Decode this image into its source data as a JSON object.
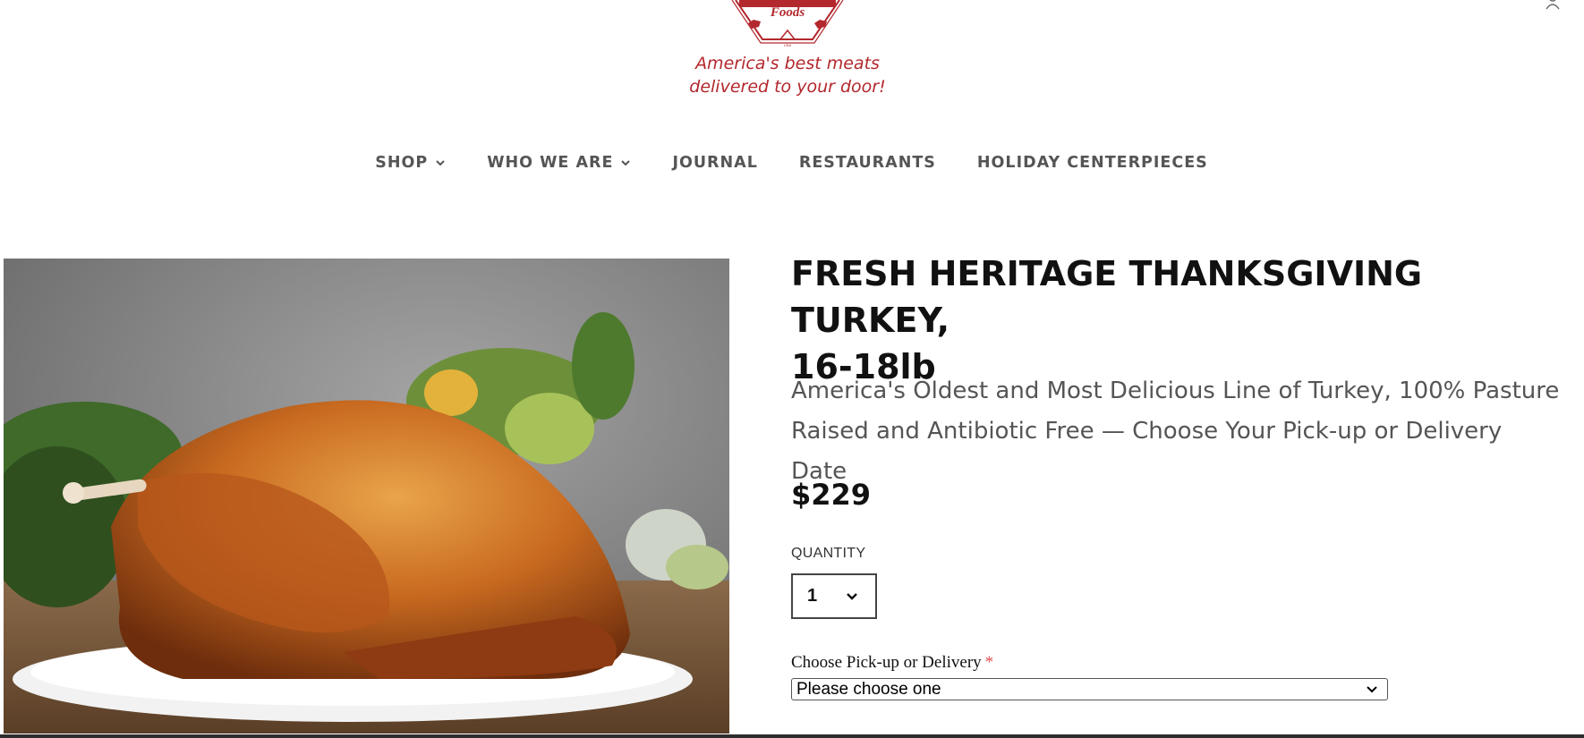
{
  "header": {
    "brand_partial": "Foods",
    "tagline_line1": "America's best meats",
    "tagline_line2": "delivered to your door!",
    "brand_color": "#b3282d"
  },
  "nav": {
    "items": [
      {
        "label": "SHOP",
        "has_dropdown": true
      },
      {
        "label": "WHO WE ARE",
        "has_dropdown": true
      },
      {
        "label": "JOURNAL",
        "has_dropdown": false
      },
      {
        "label": "RESTAURANTS",
        "has_dropdown": false
      },
      {
        "label": "HOLIDAY CENTERPIECES",
        "has_dropdown": false
      }
    ]
  },
  "product": {
    "image_alt": "Roasted heritage turkey on a white platter with vegetables",
    "title_line1": "FRESH HERITAGE THANKSGIVING TURKEY,",
    "title_line2": "16-18lb",
    "subtitle": "America's Oldest and Most Delicious Line of Turkey, 100% Pasture Raised and Antibiotic Free — Choose Your Pick-up or Delivery Date",
    "price": "$229",
    "quantity": {
      "label": "QUANTITY",
      "value": "1"
    },
    "delivery": {
      "label": "Choose Pick-up or Delivery",
      "required_marker": "*",
      "placeholder": "Please choose one"
    }
  },
  "icons": {
    "account": "user-icon",
    "dropdown": "chevron-down-icon"
  }
}
